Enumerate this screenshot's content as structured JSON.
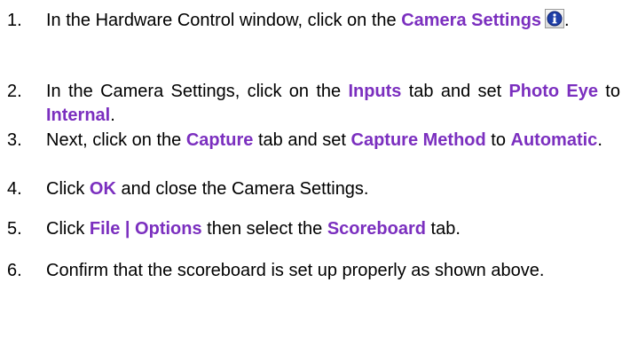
{
  "steps": [
    {
      "num": "1.",
      "p1": "In the Hardware Control window, click on the ",
      "k1": "Camera Settings",
      "p2": "."
    },
    {
      "num": "2.",
      "p1": "In the Camera Settings, click on the ",
      "k1": "Inputs",
      "p2": " tab and set ",
      "k2": "Photo Eye",
      "p3": " to ",
      "k3": "Internal",
      "p4": "."
    },
    {
      "num": "3.",
      "p1": "Next, click on the ",
      "k1": "Capture",
      "p2": " tab and set ",
      "k2": "Capture Method",
      "p3": " to ",
      "k3": "Automatic",
      "p4": "."
    },
    {
      "num": "4.",
      "p1": "Click ",
      "k1": "OK",
      "p2": " and close the Camera Settings."
    },
    {
      "num": "5.",
      "p1": "Click ",
      "k1": "File | Options",
      "p2": " then select the ",
      "k2": "Scoreboard",
      "p3": " tab."
    },
    {
      "num": "6.",
      "p1": "Confirm that the scoreboard is set up properly as shown above."
    }
  ],
  "icons": {
    "camera_settings": "info-icon"
  },
  "colors": {
    "keyword": "#7b2fbf",
    "text": "#000000",
    "icon_blue": "#1f3fa8"
  }
}
